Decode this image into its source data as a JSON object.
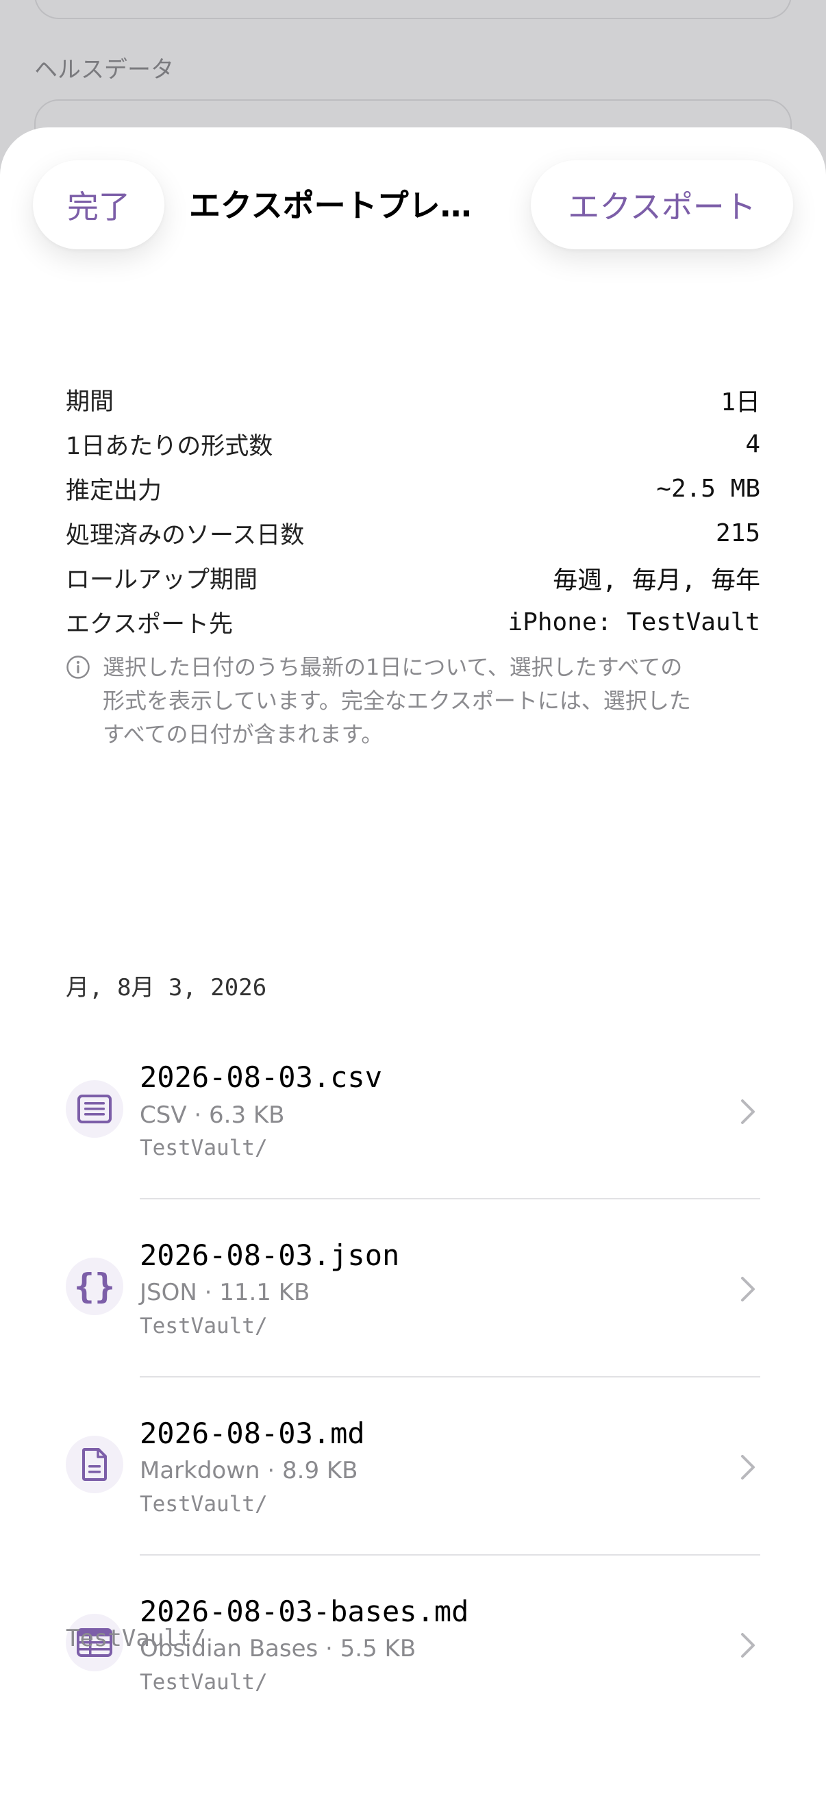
{
  "background": {
    "section_label": "ヘルスデータ"
  },
  "header": {
    "done_label": "完了",
    "title": "エクスポートプレ…",
    "export_label": "エクスポート"
  },
  "summary": [
    {
      "label": "期間",
      "value": "1日"
    },
    {
      "label": "1日あたりの形式数",
      "value": "4"
    },
    {
      "label": "推定出力",
      "value": "~2.5 MB"
    },
    {
      "label": "処理済みのソース日数",
      "value": "215"
    },
    {
      "label": "ロールアップ期間",
      "value": "毎週, 毎月, 毎年"
    },
    {
      "label": "エクスポート先",
      "value": "iPhone: TestVault"
    }
  ],
  "note": {
    "icon": "info-icon",
    "line1": "選択した日付のうち最新の1日について、選択したすべての",
    "line2": "形式を表示しています。完全なエクスポートには、選択した",
    "line3": "すべての日付が含まれます。"
  },
  "date_header": "月, 8月 3, 2026",
  "files": [
    {
      "icon": "list-document-icon",
      "name": "2026-08-03.csv",
      "meta": "CSV · 6.3 KB",
      "path": "TestVault/"
    },
    {
      "icon": "curly-braces-icon",
      "name": "2026-08-03.json",
      "meta": "JSON · 11.1 KB",
      "path": "TestVault/"
    },
    {
      "icon": "text-document-icon",
      "name": "2026-08-03.md",
      "meta": "Markdown · 8.9 KB",
      "path": "TestVault/"
    },
    {
      "icon": "table-icon",
      "name": "2026-08-03-bases.md",
      "meta": "Obsidian Bases · 5.5 KB",
      "path": "TestVault/"
    }
  ],
  "footer_path": "TestVault/",
  "colors": {
    "accent": "#7c5ea8",
    "icon_bg": "#f3f0f8",
    "secondary_text": "#8a8a8e",
    "backdrop": "#d1d1d3"
  }
}
